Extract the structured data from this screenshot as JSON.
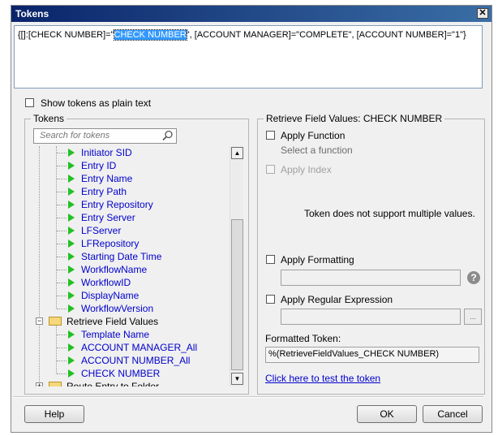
{
  "window": {
    "title": "Tokens",
    "close_glyph": "✕"
  },
  "expression": {
    "prefix": "{[]:[CHECK NUMBER]=\"",
    "selected": "CHECK NUMBER",
    "suffix": "\", [ACCOUNT MANAGER]=\"COMPLETE\", [ACCOUNT NUMBER]=\"1\"}"
  },
  "plain_text_option": {
    "label": "Show tokens as plain text",
    "checked": false
  },
  "tokens_panel": {
    "title": "Tokens",
    "search_placeholder": "Search for tokens",
    "tree": [
      {
        "label": "Initiator SID",
        "type": "leaf"
      },
      {
        "label": "Entry ID",
        "type": "leaf"
      },
      {
        "label": "Entry Name",
        "type": "leaf"
      },
      {
        "label": "Entry Path",
        "type": "leaf"
      },
      {
        "label": "Entry Repository",
        "type": "leaf"
      },
      {
        "label": "Entry Server",
        "type": "leaf"
      },
      {
        "label": "LFServer",
        "type": "leaf"
      },
      {
        "label": "LFRepository",
        "type": "leaf"
      },
      {
        "label": "Starting Date Time",
        "type": "leaf"
      },
      {
        "label": "WorkflowName",
        "type": "leaf"
      },
      {
        "label": "WorkflowID",
        "type": "leaf"
      },
      {
        "label": "DisplayName",
        "type": "leaf"
      },
      {
        "label": "WorkflowVersion",
        "type": "leaf"
      },
      {
        "label": "Retrieve Field Values",
        "type": "group",
        "expanded": true
      },
      {
        "label": "Template Name",
        "type": "child"
      },
      {
        "label": "ACCOUNT MANAGER_All",
        "type": "child"
      },
      {
        "label": "ACCOUNT NUMBER_All",
        "type": "child"
      },
      {
        "label": "CHECK NUMBER",
        "type": "child"
      },
      {
        "label": "Route Entry to Folder",
        "type": "group",
        "expanded": false
      }
    ]
  },
  "field_values_panel": {
    "title": "Retrieve Field Values: CHECK NUMBER",
    "apply_function": {
      "label": "Apply Function",
      "checked": false,
      "hint": "Select a function"
    },
    "apply_index": {
      "label": "Apply Index",
      "enabled": false
    },
    "multi_values_note": "Token does not support multiple values.",
    "apply_formatting": {
      "label": "Apply Formatting",
      "checked": false,
      "value": ""
    },
    "apply_regex": {
      "label": "Apply Regular Expression",
      "checked": false,
      "value": ""
    },
    "formatted_token_label": "Formatted Token:",
    "formatted_token_value": "%(RetrieveFieldValues_CHECK NUMBER)",
    "test_link": "Click here to test the token"
  },
  "buttons": {
    "help": "Help",
    "ok": "OK",
    "cancel": "Cancel"
  },
  "icons": {
    "help": "?",
    "regex_builder": "..."
  }
}
